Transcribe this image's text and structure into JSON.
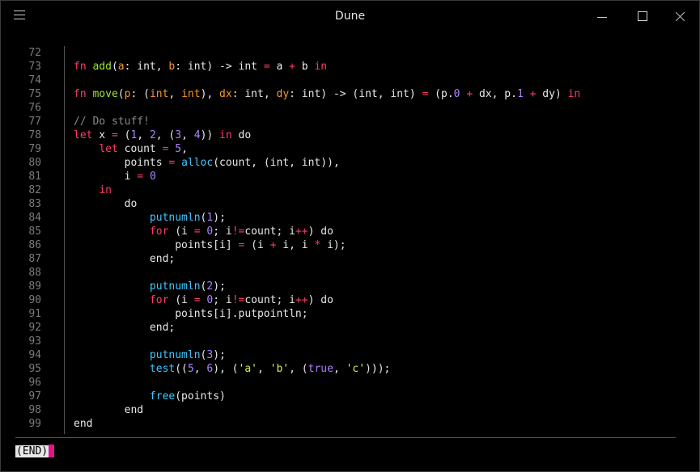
{
  "window": {
    "title": "Dune"
  },
  "colors": {
    "text": "#e8e8e8",
    "keyword": "#ff3b66",
    "function": "#a6e22e",
    "type": "#e8e8e8",
    "param": "#fd971f",
    "number": "#ae81ff",
    "string": "#d7e95a",
    "builtin": "#3fc7ff",
    "comment": "#8a8a8a",
    "cursor": "#e4138c"
  },
  "editor": {
    "lines": [
      {
        "n": "72",
        "t": []
      },
      {
        "n": "73",
        "t": [
          [
            "kw",
            "fn"
          ],
          [
            "tx",
            " "
          ],
          [
            "fn",
            "add"
          ],
          [
            "tx",
            "("
          ],
          [
            "pa",
            "a"
          ],
          [
            "tx",
            ": int, "
          ],
          [
            "pa",
            "b"
          ],
          [
            "tx",
            ": int) -> int "
          ],
          [
            "kw",
            "="
          ],
          [
            "tx",
            " a "
          ],
          [
            "kw",
            "+"
          ],
          [
            "tx",
            " b "
          ],
          [
            "kw",
            "in"
          ]
        ]
      },
      {
        "n": "74",
        "t": []
      },
      {
        "n": "75",
        "t": [
          [
            "kw",
            "fn"
          ],
          [
            "tx",
            " "
          ],
          [
            "fn",
            "move"
          ],
          [
            "tx",
            "("
          ],
          [
            "pa",
            "p"
          ],
          [
            "tx",
            ": ("
          ],
          [
            "pa",
            "int"
          ],
          [
            "tx",
            ", "
          ],
          [
            "pa",
            "int"
          ],
          [
            "tx",
            "), "
          ],
          [
            "pa",
            "dx"
          ],
          [
            "tx",
            ": int, "
          ],
          [
            "pa",
            "dy"
          ],
          [
            "tx",
            ": int) -> (int, int) "
          ],
          [
            "kw",
            "="
          ],
          [
            "tx",
            " (p."
          ],
          [
            "nu",
            "0"
          ],
          [
            "tx",
            " "
          ],
          [
            "kw",
            "+"
          ],
          [
            "tx",
            " dx, p."
          ],
          [
            "nu",
            "1"
          ],
          [
            "tx",
            " "
          ],
          [
            "kw",
            "+"
          ],
          [
            "tx",
            " dy) "
          ],
          [
            "kw",
            "in"
          ]
        ]
      },
      {
        "n": "76",
        "t": []
      },
      {
        "n": "77",
        "t": [
          [
            "cm",
            "// Do stuff!"
          ]
        ]
      },
      {
        "n": "78",
        "t": [
          [
            "kw",
            "let"
          ],
          [
            "tx",
            " x "
          ],
          [
            "kw",
            "="
          ],
          [
            "tx",
            " ("
          ],
          [
            "nu",
            "1"
          ],
          [
            "tx",
            ", "
          ],
          [
            "nu",
            "2"
          ],
          [
            "tx",
            ", ("
          ],
          [
            "nu",
            "3"
          ],
          [
            "tx",
            ", "
          ],
          [
            "nu",
            "4"
          ],
          [
            "tx",
            ")) "
          ],
          [
            "kw",
            "in"
          ],
          [
            "tx",
            " do"
          ]
        ]
      },
      {
        "n": "79",
        "t": [
          [
            "tx",
            "    "
          ],
          [
            "kw",
            "let"
          ],
          [
            "tx",
            " count "
          ],
          [
            "kw",
            "="
          ],
          [
            "tx",
            " "
          ],
          [
            "nu",
            "5"
          ],
          [
            "tx",
            ","
          ]
        ]
      },
      {
        "n": "80",
        "t": [
          [
            "tx",
            "        points "
          ],
          [
            "kw",
            "="
          ],
          [
            "tx",
            " "
          ],
          [
            "bi",
            "alloc"
          ],
          [
            "tx",
            "(count, (int, int)),"
          ]
        ]
      },
      {
        "n": "81",
        "t": [
          [
            "tx",
            "        i "
          ],
          [
            "kw",
            "="
          ],
          [
            "tx",
            " "
          ],
          [
            "nu",
            "0"
          ]
        ]
      },
      {
        "n": "82",
        "t": [
          [
            "tx",
            "    "
          ],
          [
            "kw",
            "in"
          ]
        ]
      },
      {
        "n": "83",
        "t": [
          [
            "tx",
            "        do"
          ]
        ]
      },
      {
        "n": "84",
        "t": [
          [
            "tx",
            "            "
          ],
          [
            "bi",
            "putnumln"
          ],
          [
            "tx",
            "("
          ],
          [
            "nu",
            "1"
          ],
          [
            "tx",
            ");"
          ]
        ]
      },
      {
        "n": "85",
        "t": [
          [
            "tx",
            "            "
          ],
          [
            "kw",
            "for"
          ],
          [
            "tx",
            " (i "
          ],
          [
            "kw",
            "="
          ],
          [
            "tx",
            " "
          ],
          [
            "nu",
            "0"
          ],
          [
            "tx",
            "; i"
          ],
          [
            "kw",
            "!="
          ],
          [
            "tx",
            "count; i"
          ],
          [
            "kw",
            "++"
          ],
          [
            "tx",
            ") do"
          ]
        ]
      },
      {
        "n": "86",
        "t": [
          [
            "tx",
            "                points[i] "
          ],
          [
            "kw",
            "="
          ],
          [
            "tx",
            " (i "
          ],
          [
            "kw",
            "+"
          ],
          [
            "tx",
            " i, i "
          ],
          [
            "kw",
            "*"
          ],
          [
            "tx",
            " i);"
          ]
        ]
      },
      {
        "n": "87",
        "t": [
          [
            "tx",
            "            end;"
          ]
        ]
      },
      {
        "n": "88",
        "t": []
      },
      {
        "n": "89",
        "t": [
          [
            "tx",
            "            "
          ],
          [
            "bi",
            "putnumln"
          ],
          [
            "tx",
            "("
          ],
          [
            "nu",
            "2"
          ],
          [
            "tx",
            ");"
          ]
        ]
      },
      {
        "n": "90",
        "t": [
          [
            "tx",
            "            "
          ],
          [
            "kw",
            "for"
          ],
          [
            "tx",
            " (i "
          ],
          [
            "kw",
            "="
          ],
          [
            "tx",
            " "
          ],
          [
            "nu",
            "0"
          ],
          [
            "tx",
            "; i"
          ],
          [
            "kw",
            "!="
          ],
          [
            "tx",
            "count; i"
          ],
          [
            "kw",
            "++"
          ],
          [
            "tx",
            ") do"
          ]
        ]
      },
      {
        "n": "91",
        "t": [
          [
            "tx",
            "                points[i].putpointln;"
          ]
        ]
      },
      {
        "n": "92",
        "t": [
          [
            "tx",
            "            end;"
          ]
        ]
      },
      {
        "n": "93",
        "t": []
      },
      {
        "n": "94",
        "t": [
          [
            "tx",
            "            "
          ],
          [
            "bi",
            "putnumln"
          ],
          [
            "tx",
            "("
          ],
          [
            "nu",
            "3"
          ],
          [
            "tx",
            ");"
          ]
        ]
      },
      {
        "n": "95",
        "t": [
          [
            "tx",
            "            "
          ],
          [
            "bi",
            "test"
          ],
          [
            "tx",
            "(("
          ],
          [
            "nu",
            "5"
          ],
          [
            "tx",
            ", "
          ],
          [
            "nu",
            "6"
          ],
          [
            "tx",
            "), ("
          ],
          [
            "st",
            "'a'"
          ],
          [
            "tx",
            ", "
          ],
          [
            "st",
            "'b'"
          ],
          [
            "tx",
            ", ("
          ],
          [
            "nu",
            "true"
          ],
          [
            "tx",
            ", "
          ],
          [
            "st",
            "'c'"
          ],
          [
            "tx",
            ")));"
          ]
        ]
      },
      {
        "n": "96",
        "t": []
      },
      {
        "n": "97",
        "t": [
          [
            "tx",
            "            "
          ],
          [
            "bi",
            "free"
          ],
          [
            "tx",
            "(points)"
          ]
        ]
      },
      {
        "n": "98",
        "t": [
          [
            "tx",
            "        end"
          ]
        ]
      },
      {
        "n": "99",
        "t": [
          [
            "tx",
            "end"
          ]
        ]
      }
    ]
  },
  "status": {
    "text": "(END)"
  }
}
